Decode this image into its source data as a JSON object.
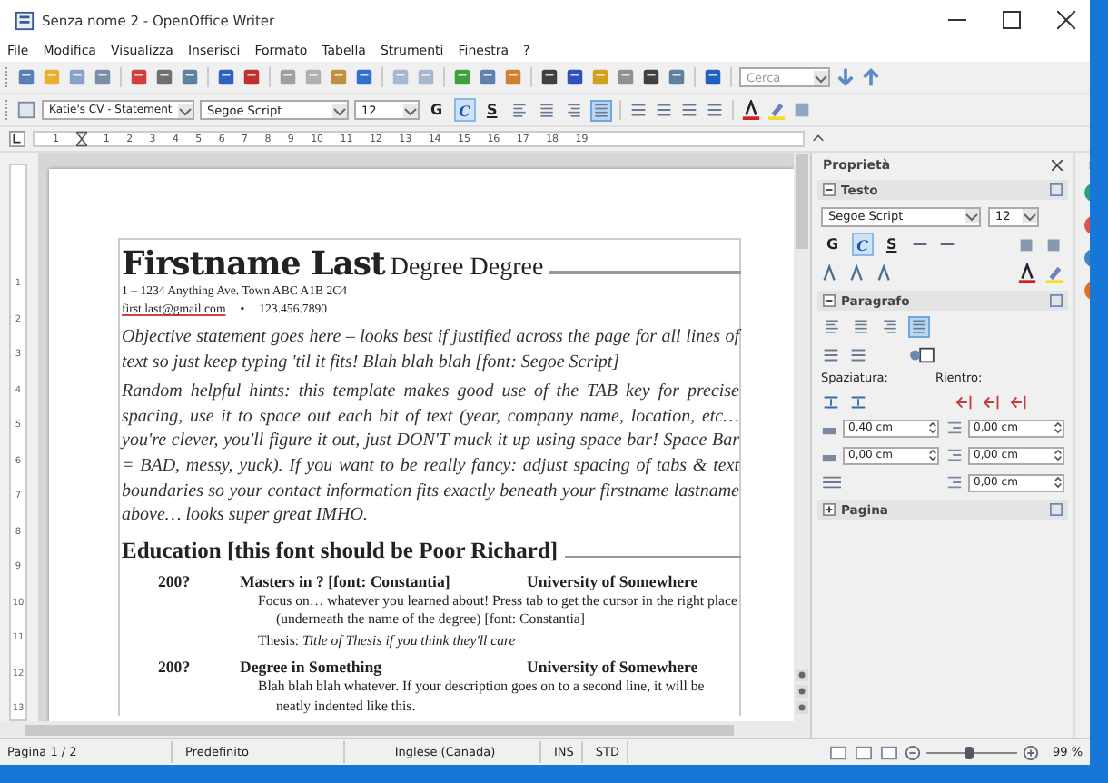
{
  "window": {
    "title": "Senza nome 2 - OpenOffice Writer"
  },
  "menu": [
    "File",
    "Modifica",
    "Visualizza",
    "Inserisci",
    "Formato",
    "Tabella",
    "Strumenti",
    "Finestra",
    "?"
  ],
  "search": {
    "placeholder": "Cerca"
  },
  "formatting": {
    "paragraph_style": "Katie's CV - Statement",
    "font": "Segoe Script",
    "size": "12",
    "styles": [
      {
        "label": "G",
        "selected": false
      },
      {
        "label": "C",
        "selected": true
      },
      {
        "label": "S",
        "selected": false
      }
    ],
    "alignment": [
      {
        "selected": false
      },
      {
        "selected": false
      },
      {
        "selected": false
      },
      {
        "selected": true
      }
    ]
  },
  "ruler": [
    "1",
    "1",
    "2",
    "3",
    "4",
    "5",
    "6",
    "7",
    "8",
    "9",
    "10",
    "11",
    "12",
    "13",
    "14",
    "15",
    "16",
    "17",
    "18",
    "19"
  ],
  "vertical_ruler": [
    "1",
    "2",
    "3",
    "4",
    "5",
    "6",
    "7",
    "8",
    "9",
    "10",
    "11",
    "12",
    "13"
  ],
  "document": {
    "name": "Firstname Last",
    "degrees": "Degree Degree",
    "address": "1 – 1234 Anything Ave. Town ABC A1B 2C4",
    "email": "first.last@gmail.com",
    "separator": "•",
    "phone": "123.456.7890",
    "paragraphs": [
      "Objective statement goes here – looks best if justified across the page for all lines of text so just keep typing 'til it fits! Blah blah blah [font: Segoe Script]",
      "Random helpful hints: this template makes good use of the TAB key for precise spacing, use it to space out each bit of text (year, company name, location, etc… you're clever, you'll figure it out, just DON'T muck it up using space bar! Space Bar = BAD, messy, yuck). If you want to be really fancy: adjust spacing  of tabs & text boundaries so your contact information fits exactly beneath your firstname lastname above… looks super great IMHO."
    ],
    "heading": "Education [this font should be Poor Richard]",
    "entries": [
      {
        "year": "200?",
        "degree": "Masters in ? [font: Constantia]",
        "school": "University of Somewhere",
        "lines": [
          "Focus on… whatever you learned about! Press tab to get the cursor in the right place (underneath the name of the degree) [font: Constantia]",
          "Thesis: *Title of Thesis if you think they'll care*"
        ]
      },
      {
        "year": "200?",
        "degree": "Degree in Something",
        "school": "University of Somewhere",
        "lines": [
          "Blah blah blah whatever. If your description goes on to a second line, it will be neatly indented like this."
        ]
      }
    ]
  },
  "sidebar": {
    "title": "Proprietà",
    "sections": [
      {
        "title": "Testo",
        "expanded": true
      },
      {
        "title": "Paragrafo",
        "expanded": true
      },
      {
        "title": "Pagina",
        "expanded": false
      }
    ],
    "font": "Segoe Script",
    "size": "12",
    "styles": [
      {
        "label": "G",
        "selected": false
      },
      {
        "label": "C",
        "selected": true
      },
      {
        "label": "S",
        "selected": false
      }
    ],
    "alignment": [
      {
        "selected": false
      },
      {
        "selected": false
      },
      {
        "selected": false
      },
      {
        "selected": true
      }
    ],
    "spacing_label": "Spaziatura:",
    "indent_label": "Rientro:",
    "spacing_fields": [
      "0,40 cm",
      "0,00 cm"
    ],
    "indent_fields": [
      "0,00 cm",
      "0,00 cm",
      "0,00 cm"
    ]
  },
  "status_bar": {
    "page": "Pagina 1 / 2",
    "style": "Predefinito",
    "language": "Inglese (Canada)",
    "insert_mode": "INS",
    "selection_mode": "STD",
    "zoom": "99 %",
    "zoom_level": {
      "level": 0.45
    }
  }
}
